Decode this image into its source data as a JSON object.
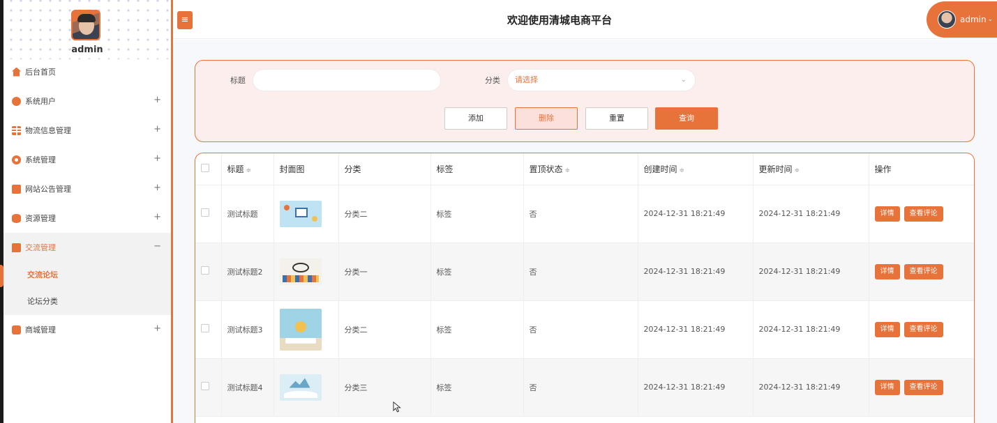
{
  "sidebar": {
    "user_name": "admin",
    "items": [
      {
        "label": "后台首页",
        "icon": "home-icon",
        "expandable": false
      },
      {
        "label": "系统用户",
        "icon": "user-icon",
        "expandable": true
      },
      {
        "label": "物流信息管理",
        "icon": "grid-icon",
        "expandable": true
      },
      {
        "label": "系统管理",
        "icon": "gear-icon",
        "expandable": true
      },
      {
        "label": "网站公告管理",
        "icon": "document-icon",
        "expandable": true
      },
      {
        "label": "资源管理",
        "icon": "database-icon",
        "expandable": true
      },
      {
        "label": "交流管理",
        "icon": "chat-icon",
        "expandable": true,
        "expanded": true,
        "children": [
          {
            "label": "交流论坛",
            "current": true
          },
          {
            "label": "论坛分类"
          }
        ]
      },
      {
        "label": "商城管理",
        "icon": "shop-icon",
        "expandable": true
      }
    ],
    "plus_symbol": "+",
    "minus_symbol": "−"
  },
  "header": {
    "toggle_symbol": "≡",
    "title": "欢迎使用清城电商平台",
    "user_label": "admin",
    "caret": "⌄"
  },
  "search": {
    "title_label": "标题",
    "title_value": "",
    "category_label": "分类",
    "category_placeholder": "请选择",
    "chevron": "⌄",
    "buttons": {
      "add": "添加",
      "delete": "删除",
      "reset": "重置",
      "query": "查询"
    }
  },
  "table": {
    "columns": [
      "标题",
      "封面图",
      "分类",
      "标签",
      "置顶状态",
      "创建时间",
      "更新时间",
      "操作"
    ],
    "sort_symbol": "≑",
    "rows": [
      {
        "title": "测试标题",
        "category": "分类二",
        "tag": "标签",
        "pinned": "否",
        "created": "2024-12-31 18:21:49",
        "updated": "2024-12-31 18:21:49"
      },
      {
        "title": "测试标题2",
        "category": "分类一",
        "tag": "标签",
        "pinned": "否",
        "created": "2024-12-31 18:21:49",
        "updated": "2024-12-31 18:21:49"
      },
      {
        "title": "测试标题3",
        "category": "分类二",
        "tag": "标签",
        "pinned": "否",
        "created": "2024-12-31 18:21:49",
        "updated": "2024-12-31 18:21:49"
      },
      {
        "title": "测试标题4",
        "category": "分类三",
        "tag": "标签",
        "pinned": "否",
        "created": "2024-12-31 18:21:49",
        "updated": "2024-12-31 18:21:49"
      }
    ],
    "actions": {
      "detail": "详情",
      "comments": "查看评论"
    }
  },
  "colors": {
    "accent": "#e8733a",
    "panel_bg": "#fbeeed",
    "content_bg": "#f7f8fc"
  }
}
